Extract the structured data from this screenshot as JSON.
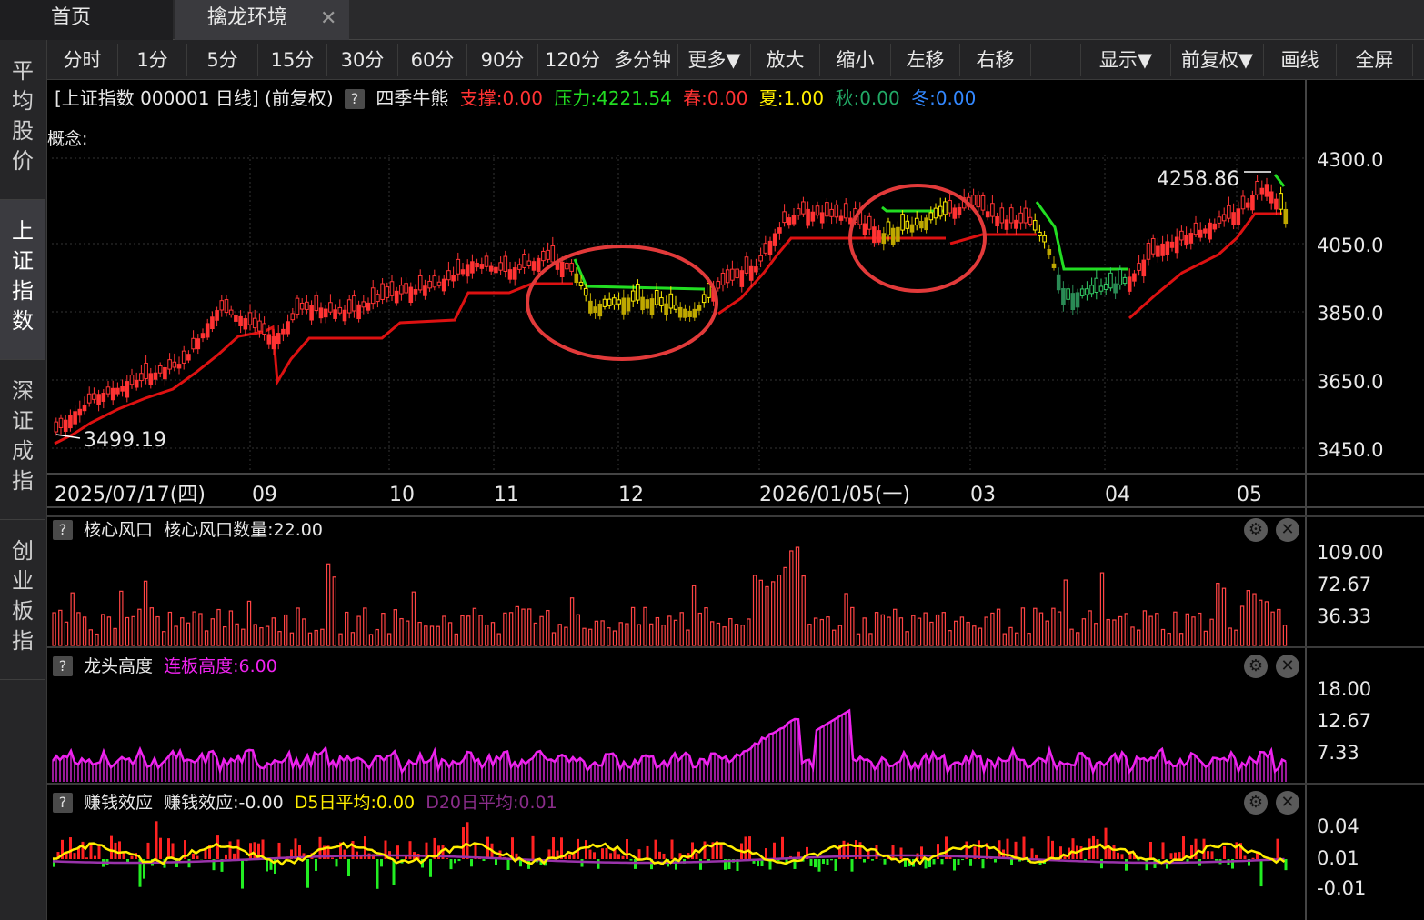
{
  "tabs": {
    "home": "首页",
    "qinlong": "擒龙环境",
    "close_glyph": "✕"
  },
  "sidebar": {
    "items": [
      {
        "label": "平\n均\n股\n价"
      },
      {
        "label": "上\n证\n指\n数"
      },
      {
        "label": "深\n证\n成\n指"
      },
      {
        "label": "创\n业\n板\n指"
      }
    ]
  },
  "toolbar": {
    "items": [
      "分时",
      "1分",
      "5分",
      "15分",
      "30分",
      "60分",
      "90分",
      "120分",
      "多分钟",
      "更多▼",
      "放大",
      "缩小",
      "左移",
      "右移",
      "显示▼",
      "前复权▼",
      "画线",
      "全屏"
    ]
  },
  "main": {
    "title": "[上证指数 000001 日线]",
    "adjust": "(前复权)",
    "q": "?",
    "indicator": "四季牛熊",
    "support": "支撑:0.00",
    "pressure": "压力:4221.54",
    "spring": "春:0.00",
    "summer": "夏:1.00",
    "autumn": "秋:0.00",
    "winter": "冬:0.00",
    "concept": "概念:",
    "high_label": "4258.86",
    "low_label": "3499.19",
    "y_ticks": [
      "4300.0",
      "4050.0",
      "3850.0",
      "3650.0",
      "3450.0"
    ],
    "x_ticks": [
      "2025/07/17(四)",
      "09",
      "10",
      "11",
      "12",
      "2026/01/05(一)",
      "03",
      "04",
      "05"
    ]
  },
  "panel1": {
    "q": "?",
    "name": "核心风口",
    "value": "核心风口数量:22.00",
    "y_ticks": [
      "109.00",
      "72.67",
      "36.33"
    ]
  },
  "panel2": {
    "q": "?",
    "name": "龙头高度",
    "value": "连板高度:6.00",
    "y_ticks": [
      "18.00",
      "12.67",
      "7.33"
    ]
  },
  "panel3": {
    "q": "?",
    "name": "赚钱效应",
    "value": "赚钱效应:-0.00",
    "d5": "D5日平均:0.00",
    "d20": "D20日平均:0.01",
    "y_ticks": [
      "0.04",
      "0.01",
      "-0.01"
    ]
  },
  "icons": {
    "gear": "⚙",
    "close": "✕"
  },
  "colors": {
    "up": "#ff3333",
    "down_yellow": "#ffee00",
    "green_line": "#22dd22",
    "magenta": "#ee22ee",
    "support_red": "#dd1111"
  }
}
